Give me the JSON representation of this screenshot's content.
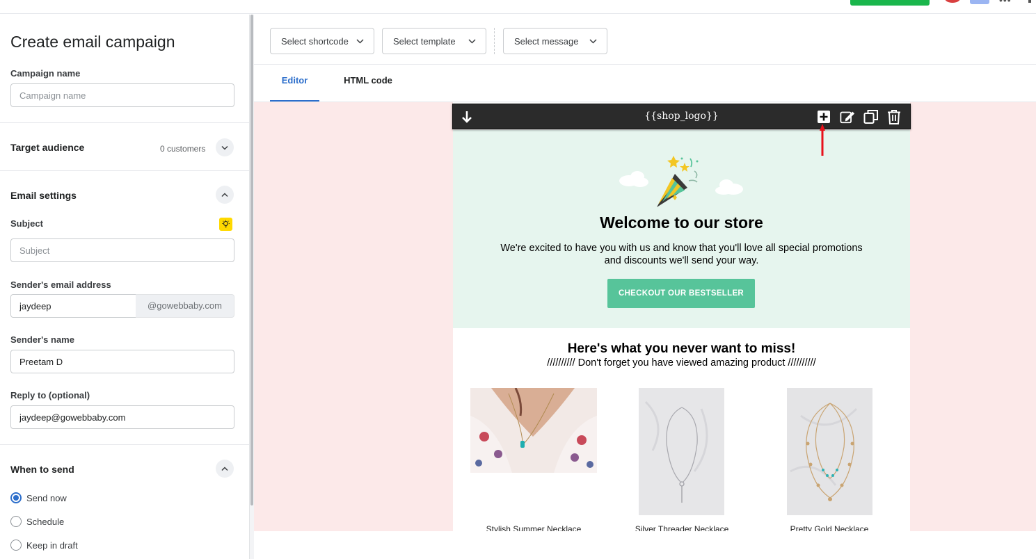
{
  "sidebar": {
    "title": "Create email campaign",
    "campaign_name": {
      "label": "Campaign name",
      "placeholder": "Campaign name",
      "value": ""
    },
    "target_audience": {
      "title": "Target audience",
      "count": "0 customers"
    },
    "email_settings": {
      "title": "Email settings",
      "subject": {
        "label": "Subject",
        "placeholder": "Subject",
        "value": ""
      },
      "sender_email": {
        "label": "Sender's email address",
        "value": "jaydeep",
        "domain": "@gowebbaby.com"
      },
      "sender_name": {
        "label": "Sender's name",
        "value": "Preetam D"
      },
      "reply_to": {
        "label": "Reply to (optional)",
        "value": "jaydeep@gowebbaby.com"
      }
    },
    "when_to_send": {
      "title": "When to send",
      "options": [
        "Send now",
        "Schedule",
        "Keep in draft"
      ],
      "selected": "Send now"
    }
  },
  "toolbar": {
    "shortcode": "Select shortcode",
    "template": "Select template",
    "message": "Select message"
  },
  "tabs": [
    "Editor",
    "HTML code"
  ],
  "active_tab": "Editor",
  "email": {
    "logo_placeholder": "{{shop_logo}}",
    "hero_title": "Welcome to our store",
    "hero_text": "We're excited to have you with us and know that you'll love all special promotions and discounts we'll send your way.",
    "cta_label": "CHECKOUT OUR BESTSELLER",
    "section_title": "Here's what you never want to miss!",
    "section_subtitle": "////////// Don't forget you have viewed amazing product //////////",
    "products": [
      {
        "name": "Stylish Summer Necklace"
      },
      {
        "name": "Silver Threader Necklace"
      },
      {
        "name": "Pretty Gold Necklace"
      }
    ]
  },
  "colors": {
    "accent": "#2c6ecb",
    "hero_bg": "#e6f5ee",
    "cta": "#57c49a",
    "canvas_bg": "#fce9e9",
    "bulb": "#ffd900",
    "arrow": "#e8111b"
  }
}
